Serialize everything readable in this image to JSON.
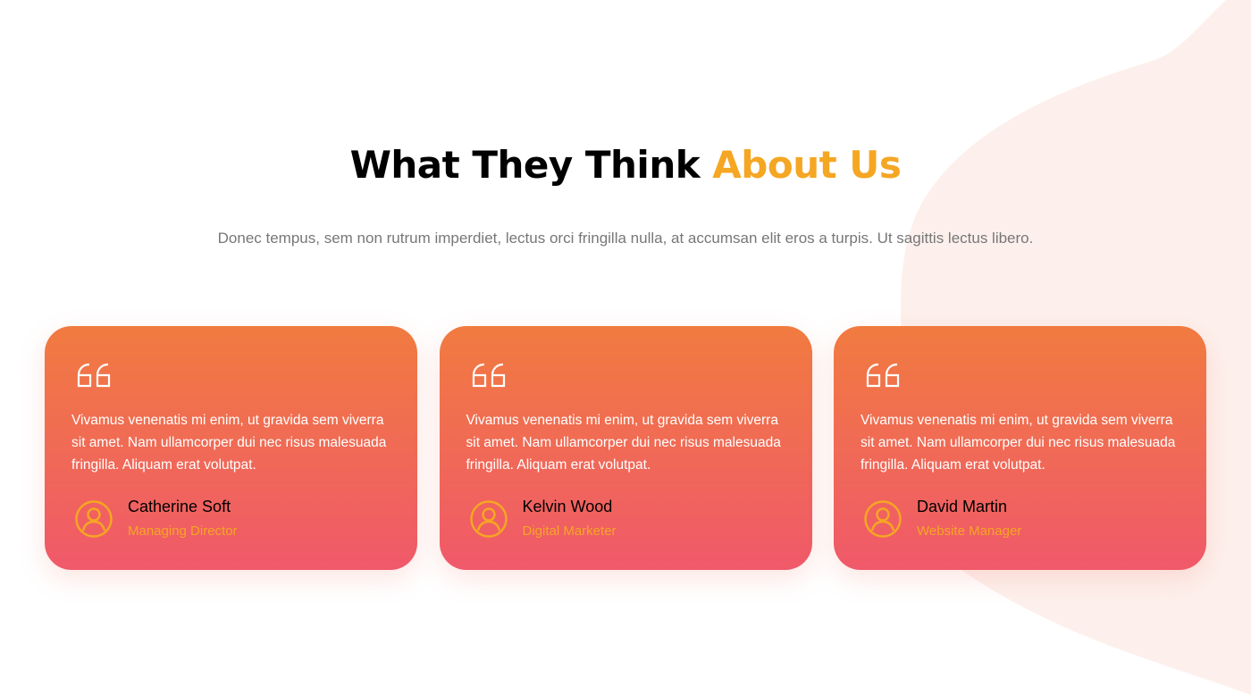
{
  "colors": {
    "accent": "#f5a623",
    "card_gradient_top": "#f17b40",
    "card_gradient_bottom": "#f0596a",
    "blob": "#fdf0ec",
    "heading": "#000000",
    "subtitle": "#777777"
  },
  "section": {
    "title_main": "What They Think ",
    "title_accent": "About Us",
    "subtitle": "Donec tempus, sem non rutrum imperdiet, lectus orci fringilla nulla, at accumsan elit eros a turpis. Ut sagittis lectus libero."
  },
  "testimonials": [
    {
      "quote_icon": "quote-icon",
      "text": "Vivamus venenatis mi enim, ut gravida sem viverra sit amet. Nam ullamcorper dui nec risus malesuada fringilla. Aliquam erat volutpat.",
      "avatar_icon": "user-icon",
      "name": "Catherine Soft",
      "role": "Managing Director"
    },
    {
      "quote_icon": "quote-icon",
      "text": "Vivamus venenatis mi enim, ut gravida sem viverra sit amet. Nam ullamcorper dui nec risus malesuada fringilla. Aliquam erat volutpat.",
      "avatar_icon": "user-icon",
      "name": "Kelvin Wood",
      "role": "Digital Marketer"
    },
    {
      "quote_icon": "quote-icon",
      "text": "Vivamus venenatis mi enim, ut gravida sem viverra sit amet. Nam ullamcorper dui nec risus malesuada fringilla. Aliquam erat volutpat.",
      "avatar_icon": "user-icon",
      "name": "David Martin",
      "role": "Website Manager"
    }
  ]
}
